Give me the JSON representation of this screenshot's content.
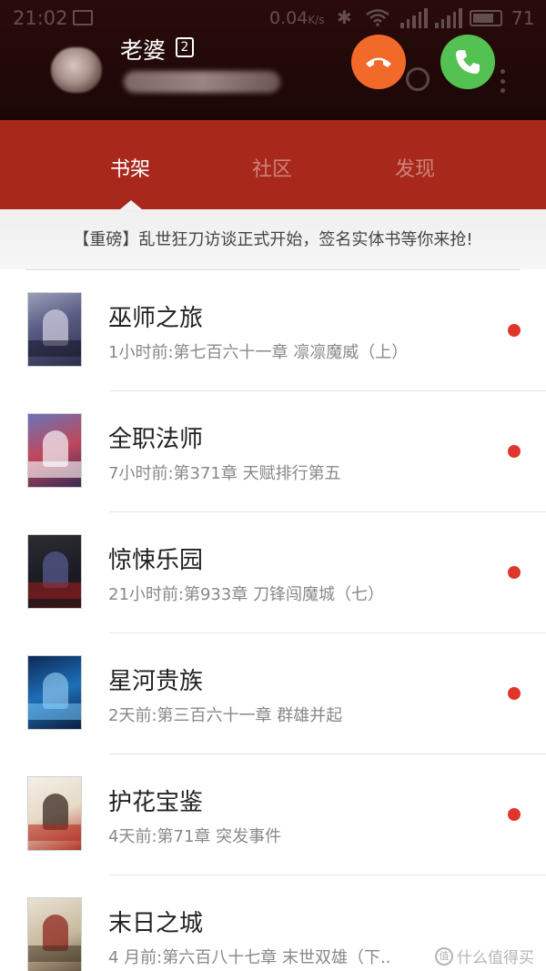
{
  "status_bar": {
    "time": "21:02",
    "net_speed": "0.04",
    "net_speed_unit": "K/s",
    "battery": "71"
  },
  "incoming_call": {
    "caller_name": "老婆",
    "sim_slot": "2",
    "decline_color": "#f26a2a",
    "answer_color": "#53c253"
  },
  "tabs": [
    {
      "label": "书架",
      "active": true
    },
    {
      "label": "社区",
      "active": false
    },
    {
      "label": "发现",
      "active": false
    }
  ],
  "colors": {
    "tab_bar": "#a8281c",
    "unread_dot": "#e0352b"
  },
  "announcement": "【重磅】乱世狂刀访谈正式开始，签名实体书等你来抢!",
  "books": [
    {
      "title": "巫师之旅",
      "update": "1小时前:第七百六十一章 凛凛魔威（上）",
      "unread": true
    },
    {
      "title": "全职法师",
      "update": "7小时前:第371章 天赋排行第五",
      "unread": true
    },
    {
      "title": "惊悚乐园",
      "update": "21小时前:第933章 刀锋闯魔城（七）",
      "unread": true
    },
    {
      "title": "星河贵族",
      "update": "2天前:第三百六十一章 群雄并起",
      "unread": true
    },
    {
      "title": "护花宝鉴",
      "update": "4天前:第71章 突发事件",
      "unread": true
    },
    {
      "title": "末日之城",
      "update": "4 月前:第六百八十七章 末世双雄（下..",
      "unread": false
    }
  ],
  "watermark": "什么值得买"
}
